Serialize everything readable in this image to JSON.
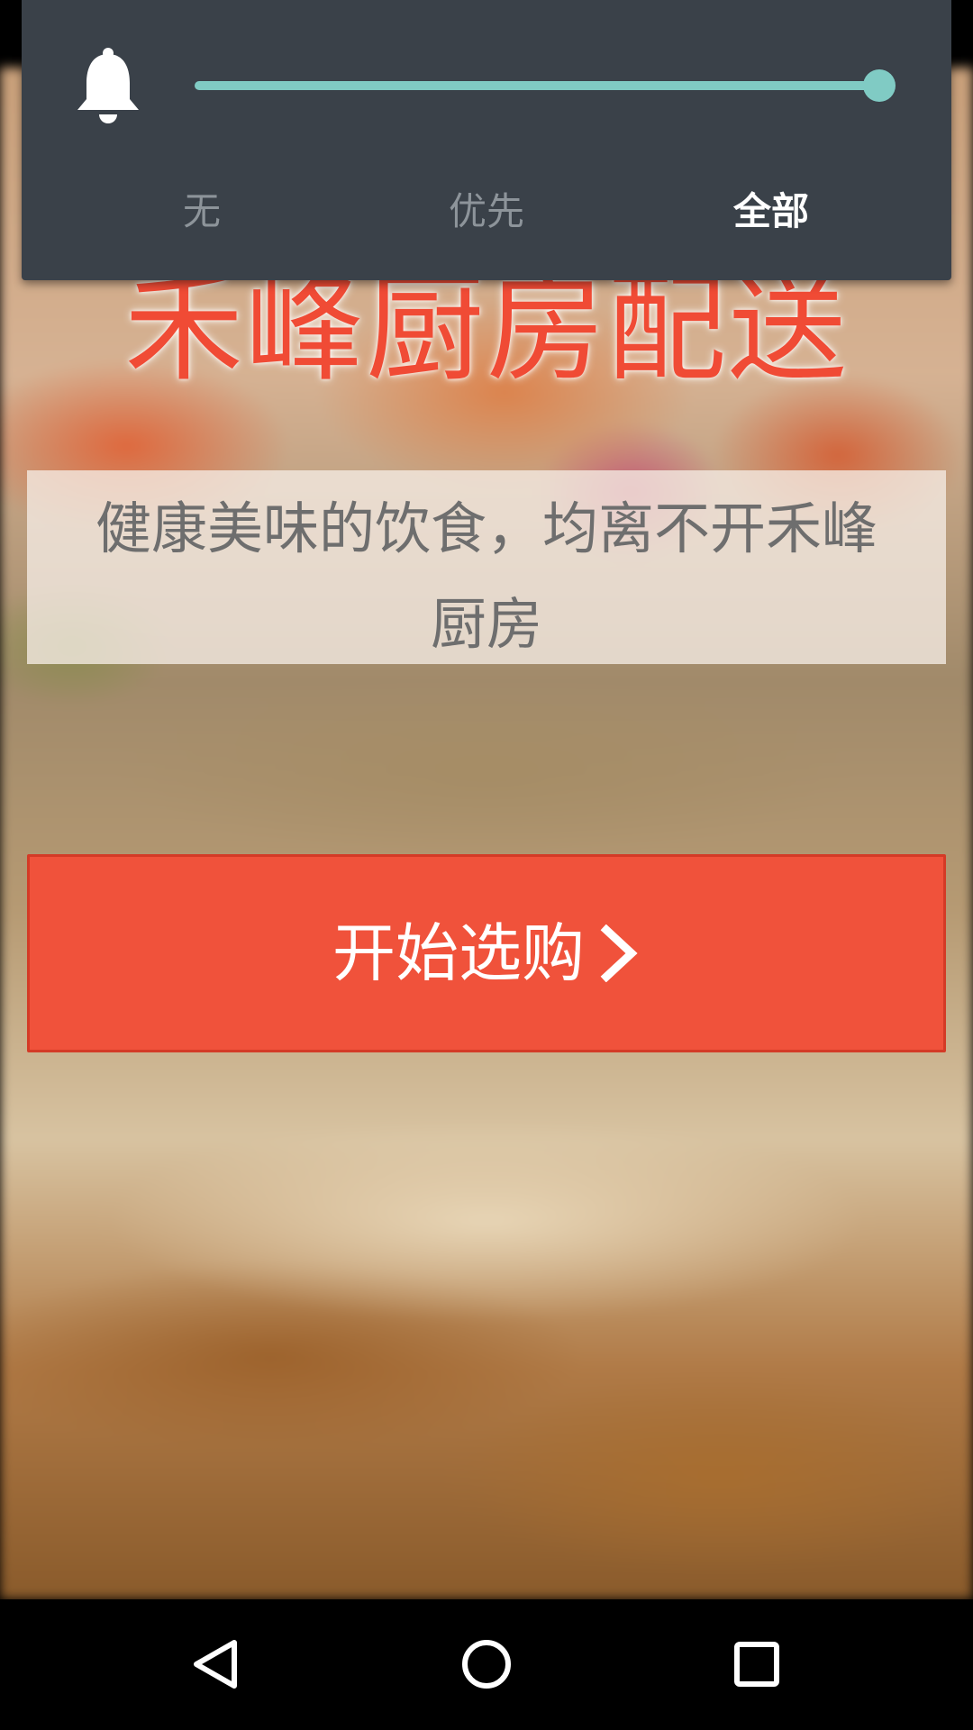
{
  "app": {
    "headline": "禾峰厨房配送",
    "subtitle": "健康美味的饮食，均离不开禾峰厨房",
    "start_button_label": "开始选购",
    "accent_color": "#f0523b"
  },
  "volume_panel": {
    "level": 1.0,
    "modes": [
      "无",
      "优先",
      "全部"
    ],
    "selected_mode": "全部",
    "slider_color": "#80cbc4",
    "icon": "bell-icon"
  },
  "navbar": {
    "icons": [
      "back-icon",
      "home-icon",
      "recents-icon"
    ]
  }
}
